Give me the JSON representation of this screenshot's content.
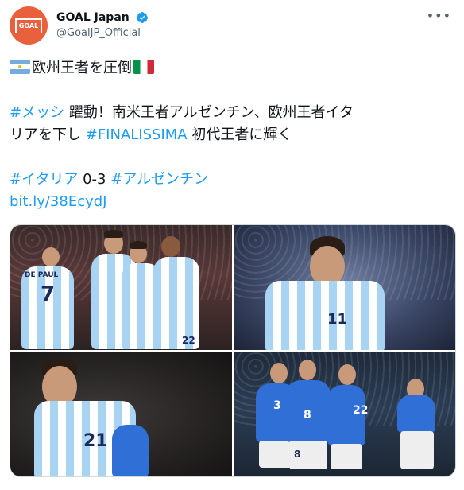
{
  "account": {
    "display_name": "GOAL Japan",
    "handle": "@GoalJP_Official",
    "avatar_text": "GOAL",
    "verified": true
  },
  "tweet": {
    "flag_left": "argentina-flag",
    "headline": "欧州王者を圧倒",
    "flag_right": "italy-flag",
    "hashtag_messi": "#メッシ",
    "line2_rest": " 躍動！南米王者アルゼンチン、欧州王者イタ",
    "line3_start": "リアを下し ",
    "hashtag_finalissima": "#FINALISSIMA",
    "line3_rest": " 初代王者に輝く",
    "hashtag_italy": "#イタリア",
    "score": " 0-3 ",
    "hashtag_argentina": "#アルゼンチン",
    "link": "bit.ly/38EcydJ"
  },
  "photos": {
    "p1_name_print": "DE PAUL",
    "p1_num_left": "7",
    "p1_num_right": "22",
    "p2_num": "11",
    "p3_num": "21",
    "p4_num_a": "3",
    "p4_num_b": "8",
    "p4_num_c": "8",
    "p4_num_d": "22"
  },
  "colors": {
    "link": "#1d9bf0",
    "text": "#0f1419",
    "muted": "#536471",
    "avatar_bg": "#e8603c",
    "verified": "#1d9bf0"
  }
}
